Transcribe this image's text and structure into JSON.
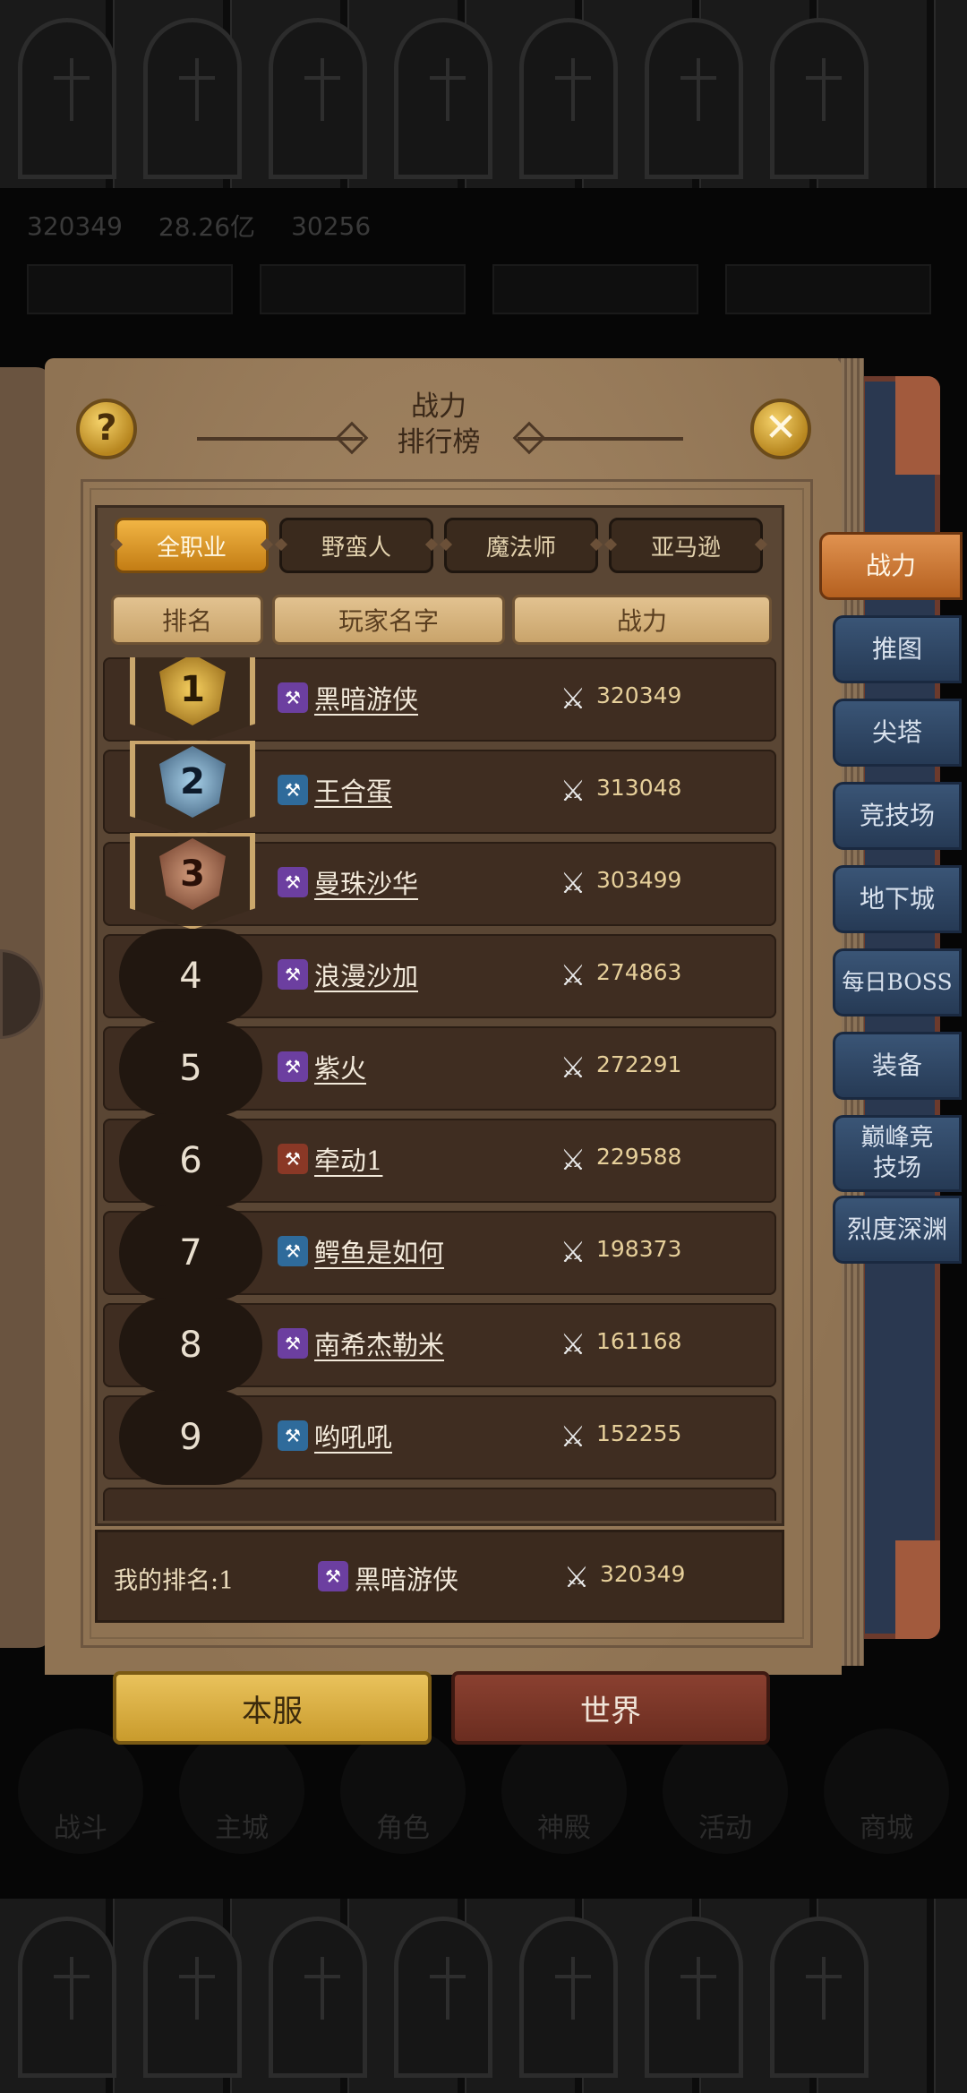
{
  "title": {
    "line1": "战力",
    "line2": "排行榜"
  },
  "help_label": "?",
  "close_label": "✕",
  "class_tabs": [
    {
      "label": "全职业",
      "active": true
    },
    {
      "label": "野蛮人",
      "active": false
    },
    {
      "label": "魔法师",
      "active": false
    },
    {
      "label": "亚马逊",
      "active": false
    }
  ],
  "columns": [
    "排名",
    "玩家名字",
    "战力"
  ],
  "rows": [
    {
      "rank": "1",
      "class_icon": "purple-class-icon",
      "name": "黑暗游侠",
      "power": "320349"
    },
    {
      "rank": "2",
      "class_icon": "blue-class-icon",
      "name": "王合蛋",
      "power": "313048"
    },
    {
      "rank": "3",
      "class_icon": "purple-class-icon",
      "name": "曼珠沙华",
      "power": "303499"
    },
    {
      "rank": "4",
      "class_icon": "purple-class-icon",
      "name": "浪漫沙加",
      "power": "274863"
    },
    {
      "rank": "5",
      "class_icon": "purple-class-icon",
      "name": "紫火",
      "power": "272291"
    },
    {
      "rank": "6",
      "class_icon": "red-class-icon",
      "name": "牵动1",
      "power": "229588"
    },
    {
      "rank": "7",
      "class_icon": "blue-class-icon",
      "name": "鳄鱼是如何",
      "power": "198373"
    },
    {
      "rank": "8",
      "class_icon": "purple-class-icon",
      "name": "南希杰勒米",
      "power": "161168"
    },
    {
      "rank": "9",
      "class_icon": "blue-class-icon",
      "name": "哟吼吼",
      "power": "152255"
    }
  ],
  "my_rank": {
    "label": "我的排名:1",
    "name": "黑暗游侠",
    "power": "320349"
  },
  "side_tabs": [
    "战力",
    "推图",
    "尖塔",
    "竞技场",
    "地下城",
    "每日BOSS",
    "装备",
    "巅峰竞\n技场",
    "烈度深渊"
  ],
  "server_tabs": {
    "local": "本服",
    "world": "世界"
  },
  "background_ui": {
    "power": "320349",
    "gold": "28.26亿",
    "gems": "30256",
    "nav": [
      "战斗",
      "主城",
      "角色",
      "神殿",
      "活动",
      "商城"
    ]
  },
  "colors": {
    "gold_accent": "#e9c25c",
    "side_tab_blue": "#3a5576",
    "side_tab_active": "#e09250",
    "class_purple": "#6c3fa0",
    "class_blue": "#2f6b9b",
    "class_red": "#8a3826"
  }
}
